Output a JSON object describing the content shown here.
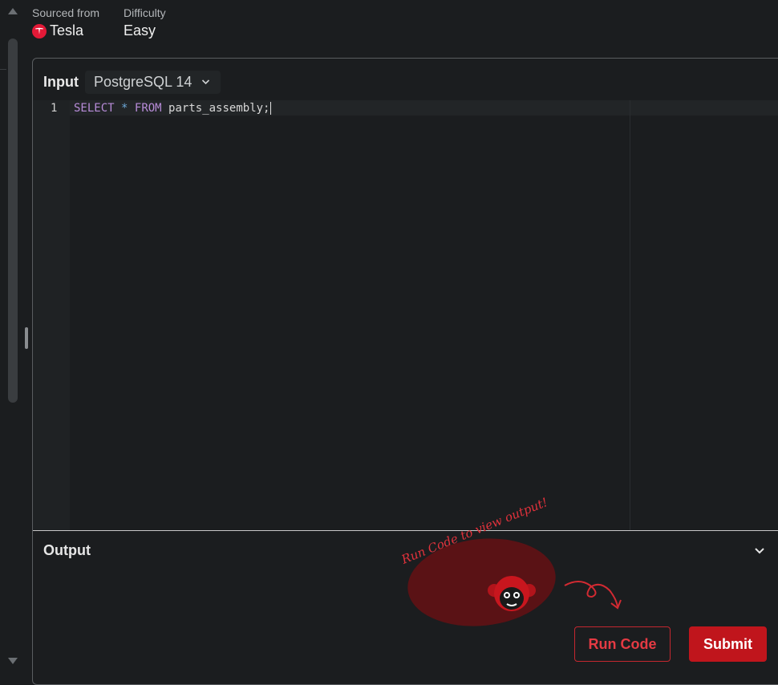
{
  "meta": {
    "source_label": "Sourced from",
    "source_value": "Tesla",
    "difficulty_label": "Difficulty",
    "difficulty_value": "Easy"
  },
  "editor": {
    "input_label": "Input",
    "language": "PostgreSQL 14",
    "line_number": "1",
    "code": {
      "kw1": "SELECT",
      "star": "*",
      "kw2": "FROM",
      "rest": "parts_assembly;"
    }
  },
  "output": {
    "label": "Output",
    "prompt": "Run Code to view output!"
  },
  "buttons": {
    "run": "Run Code",
    "submit": "Submit"
  },
  "colors": {
    "accent": "#c0151c",
    "tesla_red": "#e31937",
    "background": "#1b1d1f"
  },
  "icons": {
    "tesla": "tesla-logo-icon",
    "dropdown": "chevron-down-icon",
    "collapse": "chevron-down-icon",
    "mascot": "monkey-icon",
    "arrow": "curly-arrow-icon"
  }
}
